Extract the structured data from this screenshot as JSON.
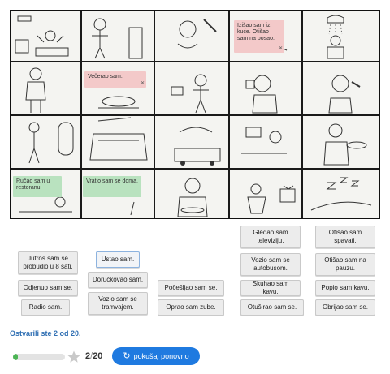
{
  "placed_captions": [
    {
      "text": "Izišao sam iz kuće. Otišao sam na posao.",
      "status": "wrong",
      "close_icon": "close-icon"
    },
    {
      "text": "Večerao sam.",
      "status": "wrong",
      "close_icon": "close-icon"
    },
    {
      "text": "Ručao sam u restoranu.",
      "status": "right"
    },
    {
      "text": "Vratio sam se doma.",
      "status": "right"
    }
  ],
  "cards": [
    {
      "text": "Gledao sam televiziju."
    },
    {
      "text": "Otišao sam spavati."
    },
    {
      "text": "Jutros sam se probudio u 8 sati."
    },
    {
      "text": "Ustao sam."
    },
    {
      "text": "Vozio sam se autobusom."
    },
    {
      "text": "Otišao sam na pauzu."
    },
    {
      "text": "Doručkovao sam."
    },
    {
      "text": "Odjenuo sam se."
    },
    {
      "text": "Počešljao sam se."
    },
    {
      "text": "Skuhao sam kavu."
    },
    {
      "text": "Popio sam kavu."
    },
    {
      "text": "Vozio sam se tramvajem."
    },
    {
      "text": "Radio sam."
    },
    {
      "text": "Oprao sam zube."
    },
    {
      "text": "Otuširao sam se."
    },
    {
      "text": "Obrijao sam se."
    }
  ],
  "result_text": "Ostvarili ste 2 od 20.",
  "progress": {
    "correct": "2",
    "separator": "/",
    "total": "20",
    "fraction": 0.1,
    "icon": "star-icon"
  },
  "retry_button": {
    "label": "pokušaj ponovno",
    "icon": "refresh-icon"
  },
  "colors": {
    "accent": "#1f7ae0",
    "wrong": "#f3c9c9",
    "right": "#b9e2bf",
    "progress": "#4cb454",
    "result": "#2f6fb3"
  }
}
